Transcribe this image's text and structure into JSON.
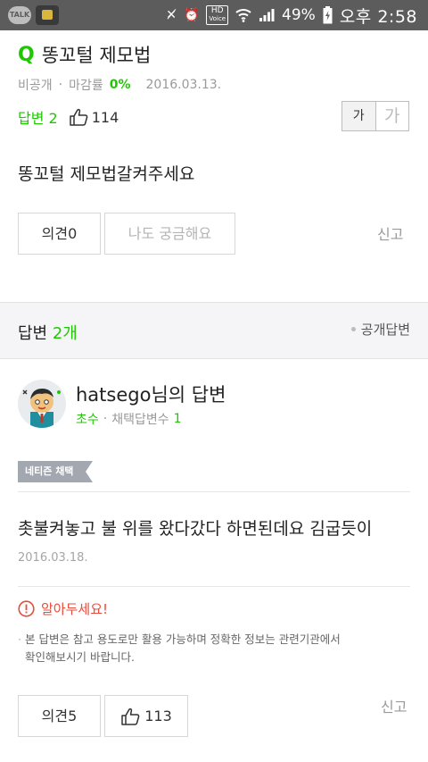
{
  "status_bar": {
    "talk_label": "TALK",
    "hd_label": "HD",
    "voice_label": "Voice",
    "battery": "49%",
    "time": "오후 2:58"
  },
  "question": {
    "q_mark": "Q",
    "title": "똥꼬털 제모법",
    "visibility": "비공개",
    "separator": "·",
    "closing_rate_label": "마감률",
    "closing_rate_value": "0%",
    "date": "2016.03.13.",
    "answers_label": "답변",
    "answers_count": "2",
    "likes": "114",
    "font_small": "가",
    "font_large": "가",
    "body": "똥꼬털 제모법갈켜주세요",
    "opinion_label": "의견",
    "opinion_count": "0",
    "curious_label": "나도 궁금해요",
    "report_label": "신고"
  },
  "answers_section": {
    "label": "답변",
    "count": "2개",
    "public_answers": "공개답변"
  },
  "answer": {
    "username": "hatsego",
    "username_suffix": "님의 답변",
    "level": "초수",
    "separator": "·",
    "adoptions_label": "채택답변수",
    "adoptions_count": "1",
    "badge": "네티즌 채택",
    "body": "촛불켜놓고 불 위를 왔다갔다 하면된데요 김굽듯이",
    "date": "2016.03.18.",
    "notice_title": "알아두세요!",
    "notice_line1": "본 답변은 참고 용도로만 활용 가능하며 정확한 정보는 관련기관에서",
    "notice_line2": "확인해보시기 바랍니다.",
    "opinion_label": "의견",
    "opinion_count": "5",
    "likes": "113",
    "report_label": "신고"
  },
  "colors": {
    "accent_green": "#1ec800",
    "status_bar": "#5c5c5c",
    "badge_gray": "#a3a8b0"
  }
}
